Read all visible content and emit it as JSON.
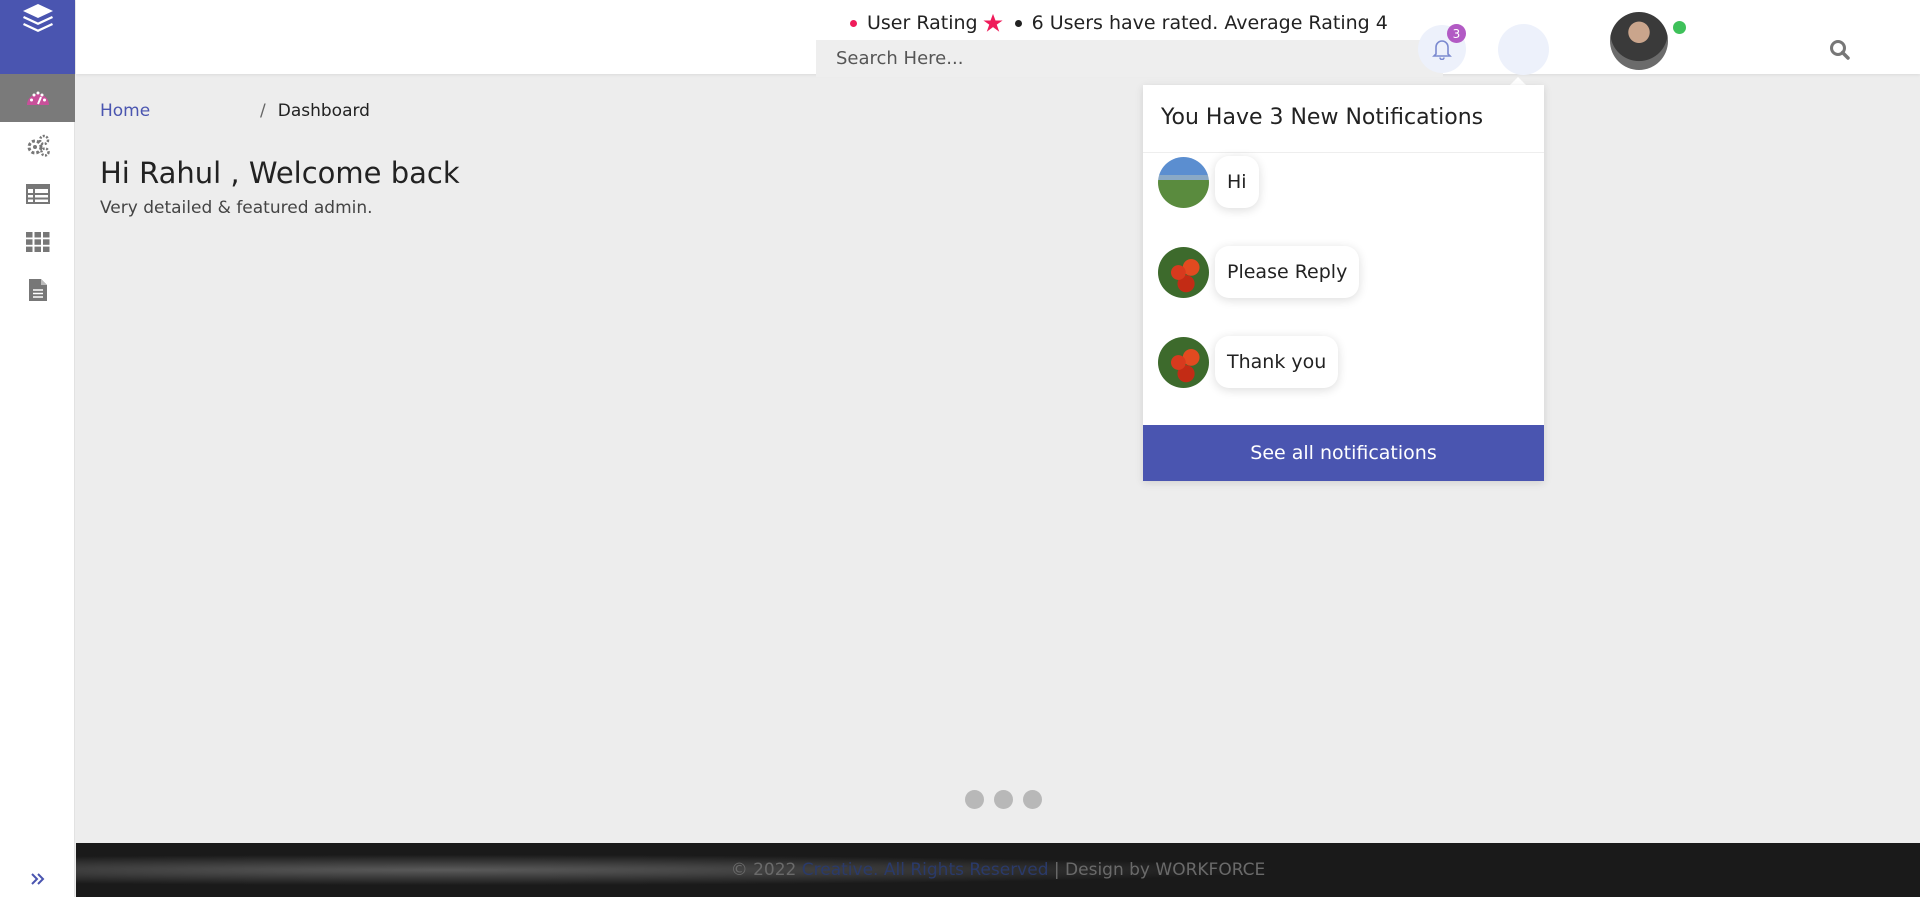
{
  "header": {
    "rating_label": "User Rating",
    "rating_summary": "6 Users have rated. Average Rating 4",
    "search_placeholder": "Search Here...",
    "notification_count": "3"
  },
  "breadcrumb": {
    "home": "Home",
    "separator": "/",
    "current": "Dashboard"
  },
  "welcome": {
    "title": "Hi Rahul , Welcome back",
    "subtitle": "Very detailed & featured admin."
  },
  "notifications": {
    "title": "You Have 3 New Notifications",
    "items": [
      {
        "message": "Hi",
        "avatar": "mountain-landscape"
      },
      {
        "message": "Please Reply",
        "avatar": "tomatoes"
      },
      {
        "message": "Thank you",
        "avatar": "tomatoes"
      }
    ],
    "see_all": "See all notifications"
  },
  "footer": {
    "copyright": "© 2022",
    "brand": "Creative. All Rights Reserved",
    "design": "| Design by WORKFORCE"
  },
  "colors": {
    "primary": "#4a55b0",
    "rating_star": "#ef1b5a",
    "badge": "#b25ac4",
    "online": "#3ec15a",
    "active_icon": "#c8509a"
  },
  "sidebar": {
    "items": [
      {
        "icon": "dashboard-gauge-icon",
        "active": true
      },
      {
        "icon": "cogs-icon",
        "active": false
      },
      {
        "icon": "table-icon",
        "active": false
      },
      {
        "icon": "grid-icon",
        "active": false
      },
      {
        "icon": "document-icon",
        "active": false
      }
    ]
  }
}
